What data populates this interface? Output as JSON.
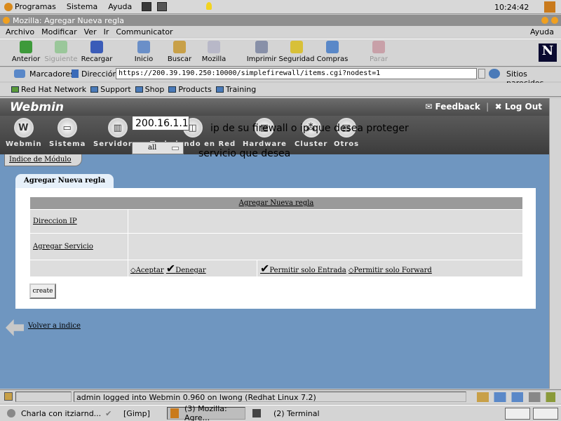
{
  "topbar": {
    "menu": [
      "Programas",
      "Sistema",
      "Ayuda"
    ],
    "clock": "10:24:42"
  },
  "window": {
    "title": "Mozilla: Agregar Nueva regla"
  },
  "menubar": {
    "items": [
      "Archivo",
      "Modificar",
      "Ver",
      "Ir",
      "Communicator"
    ],
    "help": "Ayuda"
  },
  "nav": {
    "buttons": [
      "Anterior",
      "Siguiente",
      "Recargar",
      "Inicio",
      "Buscar",
      "Mozilla",
      "Imprimir",
      "Seguridad",
      "Compras",
      "Parar"
    ]
  },
  "location": {
    "bookmarks": "Marcadores",
    "label": "Dirección:",
    "url": "https://200.39.190.250:10000/simplefirewall/items.cgi?nodest=1",
    "related": "Sitios parecidos"
  },
  "personal": {
    "items": [
      "Red Hat Network",
      "Support",
      "Shop",
      "Products",
      "Training"
    ]
  },
  "webmin": {
    "logo": "Webmin",
    "feedback": "Feedback",
    "logout": "Log Out",
    "categories": [
      "Webmin",
      "Sistema",
      "Servidores",
      "Trabajando en Red",
      "Hardware",
      "Cluster",
      "Otros"
    ],
    "module_index": "Indice de Módulo"
  },
  "page": {
    "tab": "Agregar Nueva regla",
    "table_header": "Agregar Nueva regla",
    "ip_label": "Direccion IP",
    "ip_value": "200.16.1.1",
    "ip_hint": "ip de su firewall o ip que desea proteger",
    "service_label": "Agregar Servicio",
    "service_value": "all",
    "service_hint": "servicio que desea",
    "opt_accept": "Aceptar",
    "opt_deny": "Denegar",
    "opt_in": "Permitir solo Entrada",
    "opt_fwd": "Permitir solo Forward",
    "create": "create",
    "back": "Volver a indice"
  },
  "status": {
    "text": "admin logged into Webmin 0.960 on lwong (Redhat Linux 7.2)"
  },
  "taskbar": {
    "items": [
      "Charla con itziarnd...",
      "[Gimp]",
      "(3) Mozilla: Agre...",
      "(2) Terminal"
    ]
  }
}
